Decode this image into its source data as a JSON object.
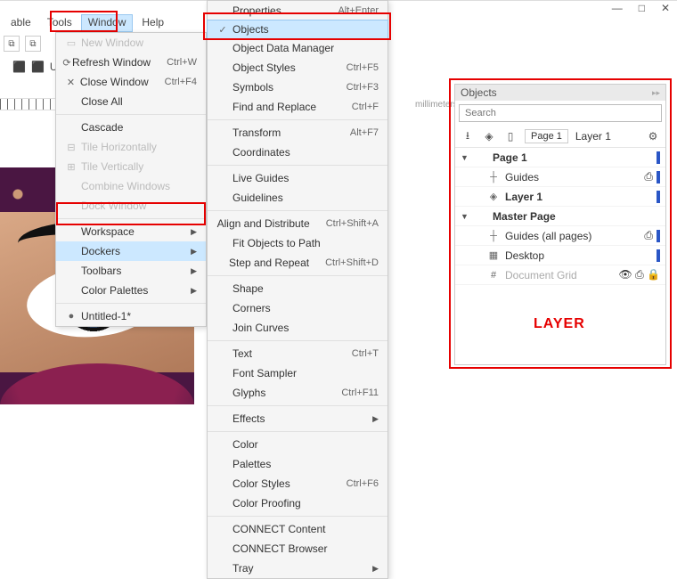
{
  "titlebar": {
    "min": "—",
    "max": "□",
    "close": "✕"
  },
  "menubar": {
    "items": [
      "able",
      "Tools",
      "Window",
      "Help"
    ],
    "active_index": 2
  },
  "toolbar2": {
    "boxes": [
      "⧉",
      "⧉",
      "⧉",
      "⬚"
    ]
  },
  "units_row": {
    "lbl1": "⬛",
    "lbl2": "⬛",
    "units_label": "Units:"
  },
  "ruler_units_hint": "millimeters",
  "window_menu": {
    "items": [
      {
        "icon": "▭",
        "label": "New Window",
        "shortcut": "",
        "disabled": true
      },
      {
        "icon": "⟳",
        "label": "Refresh Window",
        "shortcut": "Ctrl+W"
      },
      {
        "icon": "✕",
        "label": "Close Window",
        "shortcut": "Ctrl+F4"
      },
      {
        "icon": "",
        "label": "Close All",
        "shortcut": ""
      },
      {
        "sep": true
      },
      {
        "icon": "",
        "label": "Cascade",
        "shortcut": ""
      },
      {
        "icon": "⊟",
        "label": "Tile Horizontally",
        "shortcut": "",
        "disabled": true
      },
      {
        "icon": "⊞",
        "label": "Tile Vertically",
        "shortcut": "",
        "disabled": true
      },
      {
        "icon": "",
        "label": "Combine Windows",
        "shortcut": "",
        "disabled": true
      },
      {
        "icon": "",
        "label": "Dock Window",
        "shortcut": "",
        "disabled": true
      },
      {
        "sep": true
      },
      {
        "icon": "",
        "label": "Workspace",
        "shortcut": "",
        "submenu": true
      },
      {
        "icon": "",
        "label": "Dockers",
        "shortcut": "",
        "submenu": true,
        "highlight": true
      },
      {
        "icon": "",
        "label": "Toolbars",
        "shortcut": "",
        "submenu": true
      },
      {
        "icon": "",
        "label": "Color Palettes",
        "shortcut": "",
        "submenu": true
      },
      {
        "sep": true
      },
      {
        "icon": "●",
        "label": "Untitled-1*",
        "shortcut": ""
      }
    ]
  },
  "dockers_menu": {
    "items": [
      {
        "label": "Properties",
        "shortcut": "Alt+Enter"
      },
      {
        "label": "Objects",
        "shortcut": "",
        "check": true,
        "selected": true
      },
      {
        "label": "Object Data Manager",
        "shortcut": ""
      },
      {
        "label": "Object Styles",
        "shortcut": "Ctrl+F5"
      },
      {
        "label": "Symbols",
        "shortcut": "Ctrl+F3"
      },
      {
        "label": "Find and Replace",
        "shortcut": "Ctrl+F"
      },
      {
        "sep": true
      },
      {
        "label": "Transform",
        "shortcut": "Alt+F7"
      },
      {
        "label": "Coordinates",
        "shortcut": ""
      },
      {
        "sep": true
      },
      {
        "label": "Live Guides",
        "shortcut": ""
      },
      {
        "label": "Guidelines",
        "shortcut": ""
      },
      {
        "sep": true
      },
      {
        "label": "Align and Distribute",
        "shortcut": "Ctrl+Shift+A"
      },
      {
        "label": "Fit Objects to Path",
        "shortcut": ""
      },
      {
        "label": "Step and Repeat",
        "shortcut": "Ctrl+Shift+D"
      },
      {
        "sep": true
      },
      {
        "label": "Shape",
        "shortcut": ""
      },
      {
        "label": "Corners",
        "shortcut": ""
      },
      {
        "label": "Join Curves",
        "shortcut": ""
      },
      {
        "sep": true
      },
      {
        "label": "Text",
        "shortcut": "Ctrl+T"
      },
      {
        "label": "Font Sampler",
        "shortcut": ""
      },
      {
        "label": "Glyphs",
        "shortcut": "Ctrl+F11"
      },
      {
        "sep": true
      },
      {
        "label": "Effects",
        "shortcut": "",
        "submenu": true
      },
      {
        "sep": true
      },
      {
        "label": "Color",
        "shortcut": ""
      },
      {
        "label": "Palettes",
        "shortcut": ""
      },
      {
        "label": "Color Styles",
        "shortcut": "Ctrl+F6"
      },
      {
        "label": "Color Proofing",
        "shortcut": ""
      },
      {
        "sep": true
      },
      {
        "label": "CONNECT Content",
        "shortcut": ""
      },
      {
        "label": "CONNECT Browser",
        "shortcut": ""
      },
      {
        "label": "Tray",
        "shortcut": "",
        "submenu": true
      }
    ]
  },
  "objects_panel": {
    "title": "Objects",
    "search_placeholder": "Search",
    "page_label": "Page 1",
    "layer_label": "Layer 1",
    "gear": "⚙",
    "tree": [
      {
        "tw": "▼",
        "label": "Page 1",
        "bold": true,
        "bar": true
      },
      {
        "lvl": 1,
        "icon": "┼",
        "label": "Guides",
        "indic": "⎙",
        "bar": true
      },
      {
        "lvl": 1,
        "icon": "◈",
        "label": "Layer 1",
        "bold": true,
        "indic": "",
        "bar": true
      },
      {
        "tw": "▼",
        "label": "Master Page",
        "bold": true
      },
      {
        "lvl": 1,
        "icon": "┼",
        "label": "Guides (all pages)",
        "indic": "⎙",
        "bar": true
      },
      {
        "lvl": 1,
        "icon": "▦",
        "label": "Desktop",
        "indic": "",
        "bar": true
      },
      {
        "lvl": 1,
        "icon": "#",
        "label": "Document Grid",
        "indic": "👁 ⎙ 🔒",
        "grey": true
      }
    ],
    "layer_text": "LAYER"
  }
}
